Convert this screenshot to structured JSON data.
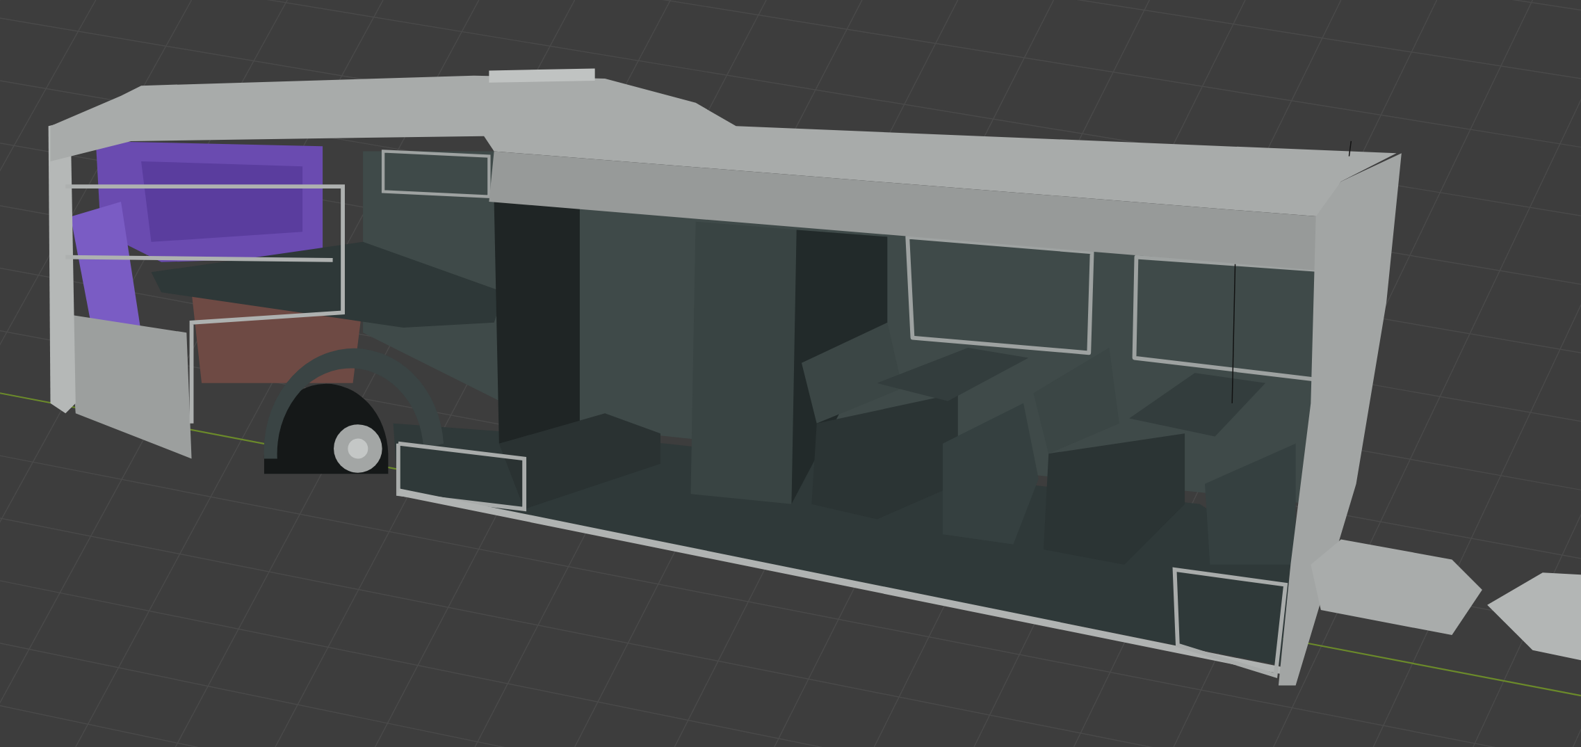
{
  "viewport": {
    "grid_visible": true,
    "axis_visible": true
  }
}
